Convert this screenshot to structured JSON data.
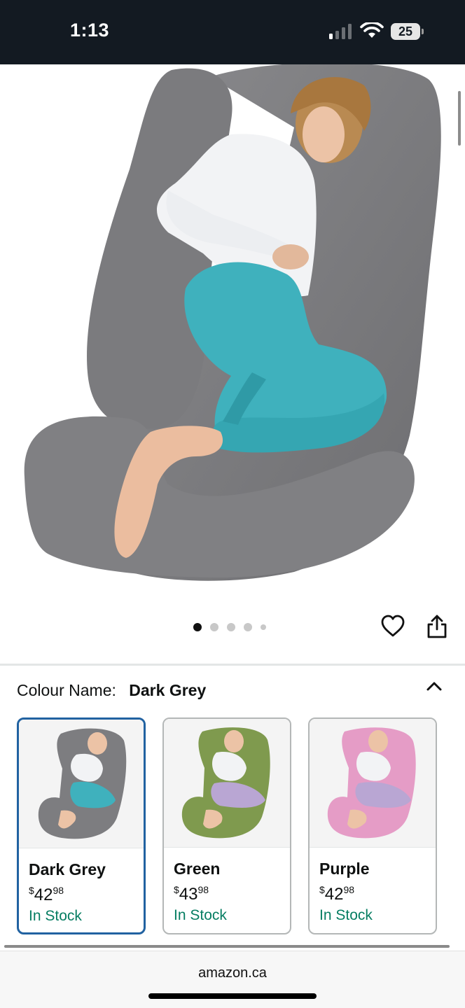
{
  "status_bar": {
    "time": "1:13",
    "battery": "25",
    "icons": [
      "signal-icon",
      "wifi-icon",
      "battery-icon"
    ]
  },
  "product_image": {
    "pager": {
      "count": 5,
      "active_index": 0
    },
    "actions": [
      "heart-icon",
      "share-icon"
    ]
  },
  "colour_selector": {
    "label": "Colour Name:",
    "selected": "Dark Grey",
    "options": [
      {
        "name": "Dark Grey",
        "currency": "$",
        "price_whole": "42",
        "price_fraction": "98",
        "stock": "In Stock",
        "pillow_color": "#7d7d80"
      },
      {
        "name": "Green",
        "currency": "$",
        "price_whole": "43",
        "price_fraction": "98",
        "stock": "In Stock",
        "pillow_color": "#7f9a4e"
      },
      {
        "name": "Purple",
        "currency": "$",
        "price_whole": "42",
        "price_fraction": "98",
        "stock": "In Stock",
        "pillow_color": "#e59cc6"
      }
    ]
  },
  "browser": {
    "url": "amazon.ca"
  },
  "colors": {
    "status_bg": "#131a22",
    "selected_border": "#2162a1",
    "stock_green": "#067d62",
    "leggings": "#3fb1bd"
  }
}
